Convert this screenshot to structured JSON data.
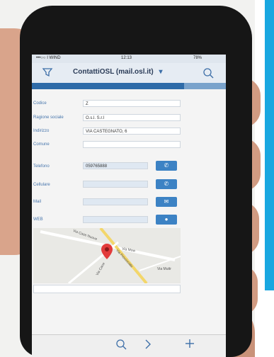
{
  "status": {
    "carrier": "•••○○ I WIND",
    "time": "12:13",
    "battery": "78%"
  },
  "header": {
    "title": "ContattiOSL (mail.osl.it)",
    "dropdown_glyph": "▾"
  },
  "fields": [
    {
      "label": "Codice",
      "value": "Z"
    },
    {
      "label": "Ragione sociale",
      "value": "O.s.l. S.r.l"
    },
    {
      "label": "Indirizzo",
      "value": "VIA CASTEGNATO, 6"
    },
    {
      "label": "Comune",
      "value": ""
    },
    {
      "label": "Telefono",
      "value": "059765888"
    },
    {
      "label": "Cellulare",
      "value": ""
    },
    {
      "label": "Mail",
      "value": ""
    },
    {
      "label": "WEB",
      "value": ""
    }
  ],
  "map": {
    "labels": [
      "Via Case Nuove",
      "Via Mow",
      "Via Provinciale",
      "Via Muttr",
      "Via Cane"
    ]
  },
  "icons": [
    "filter-icon",
    "search-icon",
    "phone-icon",
    "mail-icon",
    "globe-icon",
    "map-pin-icon",
    "search-icon",
    "forward-icon",
    "plus-icon"
  ]
}
